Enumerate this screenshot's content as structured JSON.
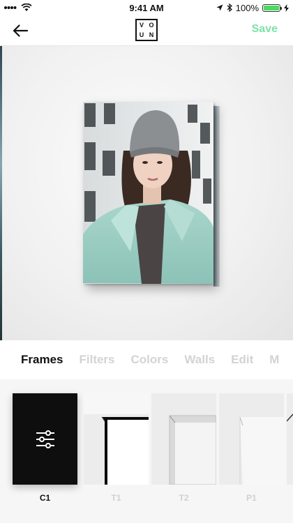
{
  "status_bar": {
    "time": "9:41 AM",
    "battery": "100%",
    "battery_level": 1.0
  },
  "nav": {
    "back_icon": "arrow-left-icon",
    "logo": {
      "letters": [
        "V",
        "O",
        "U",
        "N"
      ]
    },
    "save_label": "Save",
    "save_color": "#7ee3a8"
  },
  "tabs": [
    {
      "label": "Frames",
      "active": true
    },
    {
      "label": "Filters",
      "active": false
    },
    {
      "label": "Colors",
      "active": false
    },
    {
      "label": "Walls",
      "active": false
    },
    {
      "label": "Edit",
      "active": false
    },
    {
      "label": "M",
      "active": false
    }
  ],
  "frames": [
    {
      "label": "C1",
      "selected": true,
      "icon": "sliders-icon"
    },
    {
      "label": "T1",
      "selected": false
    },
    {
      "label": "T2",
      "selected": false
    },
    {
      "label": "P1",
      "selected": false
    }
  ]
}
